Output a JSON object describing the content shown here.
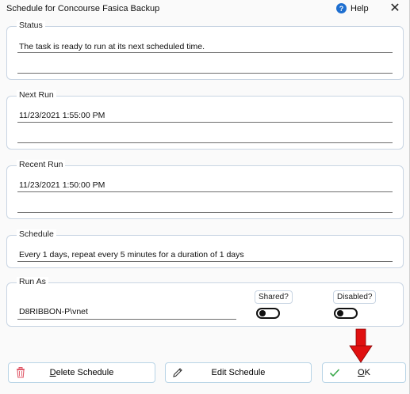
{
  "window": {
    "title": "Schedule for Concourse Fasica Backup",
    "help_label": "Help",
    "close_glyph": "✕"
  },
  "status": {
    "legend": "Status",
    "text": "The task is ready to run at its next scheduled time."
  },
  "next_run": {
    "legend": "Next Run",
    "value": "11/23/2021 1:55:00 PM"
  },
  "recent_run": {
    "legend": "Recent Run",
    "value": "11/23/2021 1:50:00 PM"
  },
  "schedule": {
    "legend": "Schedule",
    "text": "Every 1 days, repeat every 5 minutes for a duration of 1 days"
  },
  "run_as": {
    "legend": "Run As",
    "user": "D8RIBBON-P\\vnet",
    "shared_label": "Shared?",
    "disabled_label": "Disabled?",
    "shared_on": false,
    "disabled_on": false
  },
  "buttons": {
    "delete_first": "D",
    "delete_rest": "elete Schedule",
    "edit": "Edit Schedule",
    "ok_first": "O",
    "ok_rest": "K"
  },
  "colors": {
    "accent_blue": "#1e6fd0",
    "delete_icon": "#e05a6a",
    "ok_check": "#3aa84a",
    "annotation_arrow": "#e01010"
  }
}
